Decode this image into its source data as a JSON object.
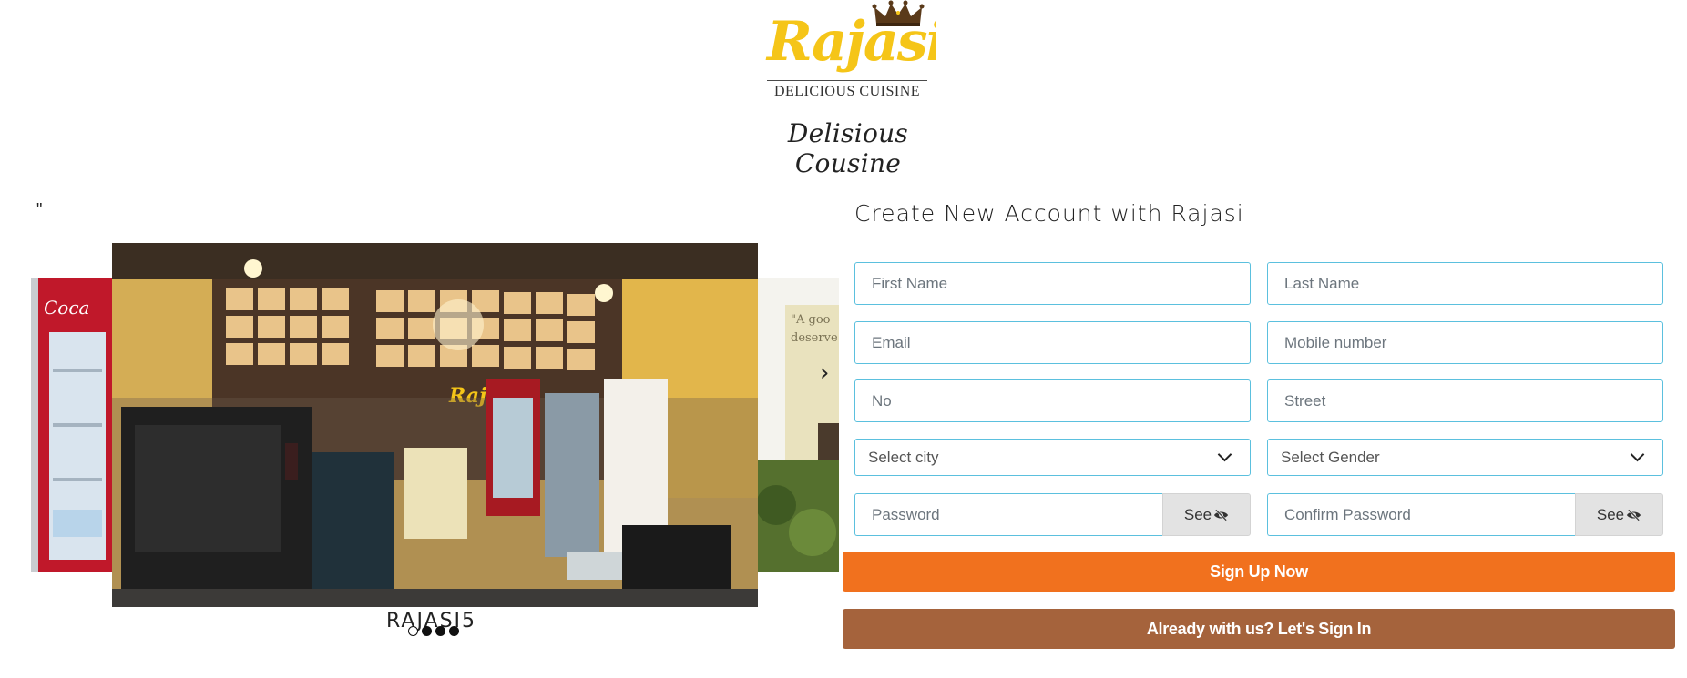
{
  "logo": {
    "brand": "Rajasi",
    "tagline": "DELICIOUS CUISINE",
    "subtitle": "Delisious Cousine"
  },
  "slider": {
    "quote_mark": "\"",
    "caption": "RAJASI5",
    "dots": [
      {
        "active": false
      },
      {
        "active": true
      },
      {
        "active": true
      },
      {
        "active": true
      }
    ]
  },
  "form": {
    "title": "Create New Account with Rajasi",
    "first_name_placeholder": "First Name",
    "last_name_placeholder": "Last Name",
    "email_placeholder": "Email",
    "mobile_placeholder": "Mobile number",
    "no_placeholder": "No",
    "street_placeholder": "Street",
    "city_select": "Select city",
    "gender_select": "Select Gender",
    "password_placeholder": "Password",
    "confirm_password_placeholder": "Confirm Password",
    "see_label": "See",
    "signup_label": "Sign Up Now",
    "signin_label": "Already with us? Let's Sign In"
  },
  "colors": {
    "field_border": "#5bc0de",
    "signup_bg": "#f1711e",
    "signin_bg": "#a5633c",
    "logo_gold": "#f5c518",
    "crown": "#5a3a1a"
  }
}
